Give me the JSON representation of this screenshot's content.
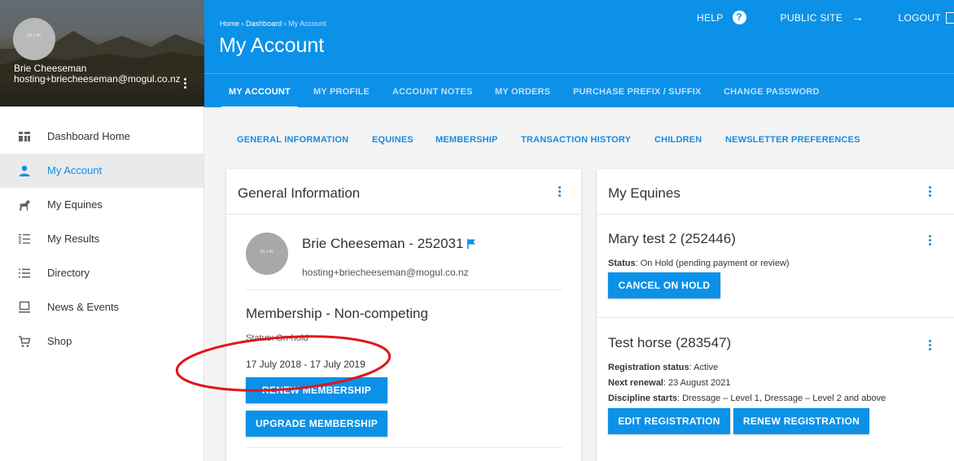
{
  "sidebar": {
    "avatar_text": "80 x 80",
    "user_name": "Brie Cheeseman",
    "user_email": "hosting+briecheeseman@mogul.co.nz",
    "items": [
      {
        "label": "Dashboard Home",
        "icon": "dashboard-icon"
      },
      {
        "label": "My Account",
        "icon": "person-icon"
      },
      {
        "label": "My Equines",
        "icon": "horse-icon"
      },
      {
        "label": "My Results",
        "icon": "results-list-icon"
      },
      {
        "label": "Directory",
        "icon": "directory-list-icon"
      },
      {
        "label": "News & Events",
        "icon": "monitor-icon"
      },
      {
        "label": "Shop",
        "icon": "cart-icon"
      }
    ]
  },
  "header": {
    "breadcrumb": {
      "home": "Home",
      "sep": "›",
      "dashboard": "Dashboard",
      "current": "My Account"
    },
    "title": "My Account",
    "help_label": "HELP",
    "public_site_label": "PUBLIC SITE",
    "logout_label": "LOGOUT",
    "tabs": [
      "MY ACCOUNT",
      "MY PROFILE",
      "ACCOUNT NOTES",
      "MY ORDERS",
      "PURCHASE PREFIX / SUFFIX",
      "CHANGE PASSWORD"
    ]
  },
  "sub_tabs": [
    "GENERAL INFORMATION",
    "EQUINES",
    "MEMBERSHIP",
    "TRANSACTION HISTORY",
    "CHILDREN",
    "NEWSLETTER PREFERENCES"
  ],
  "general_info": {
    "title": "General Information",
    "avatar_text": "80 x 80",
    "name": "Brie Cheeseman - 252031",
    "email": "hosting+briecheeseman@mogul.co.nz",
    "membership_title": "Membership - Non-competing",
    "status": "Status: On-hold",
    "dates": "17 July 2018 - 17 July 2019",
    "renew_button": "RENEW MEMBERSHIP",
    "upgrade_button": "UPGRADE MEMBERSHIP"
  },
  "my_equines": {
    "title": "My Equines",
    "horses": [
      {
        "name": "Mary test 2 (252446)",
        "status_label": "Status",
        "status_value": ": On Hold (pending payment or review)",
        "button": "CANCEL ON HOLD"
      },
      {
        "name": "Test horse (283547)",
        "reg_label": "Registration status",
        "reg_value": ": Active",
        "renewal_label": "Next renewal",
        "renewal_value": ": 23 August 2021",
        "discipline_label": "Discipline starts",
        "discipline_value": ": Dressage – Level 1, Dressage – Level 2 and above",
        "edit_button": "EDIT REGISTRATION",
        "renew_button": "RENEW REGISTRATION"
      }
    ]
  },
  "colors": {
    "primary": "#0b91e8",
    "accent_text": "#1a8bdc",
    "annotation": "#e3141b"
  }
}
